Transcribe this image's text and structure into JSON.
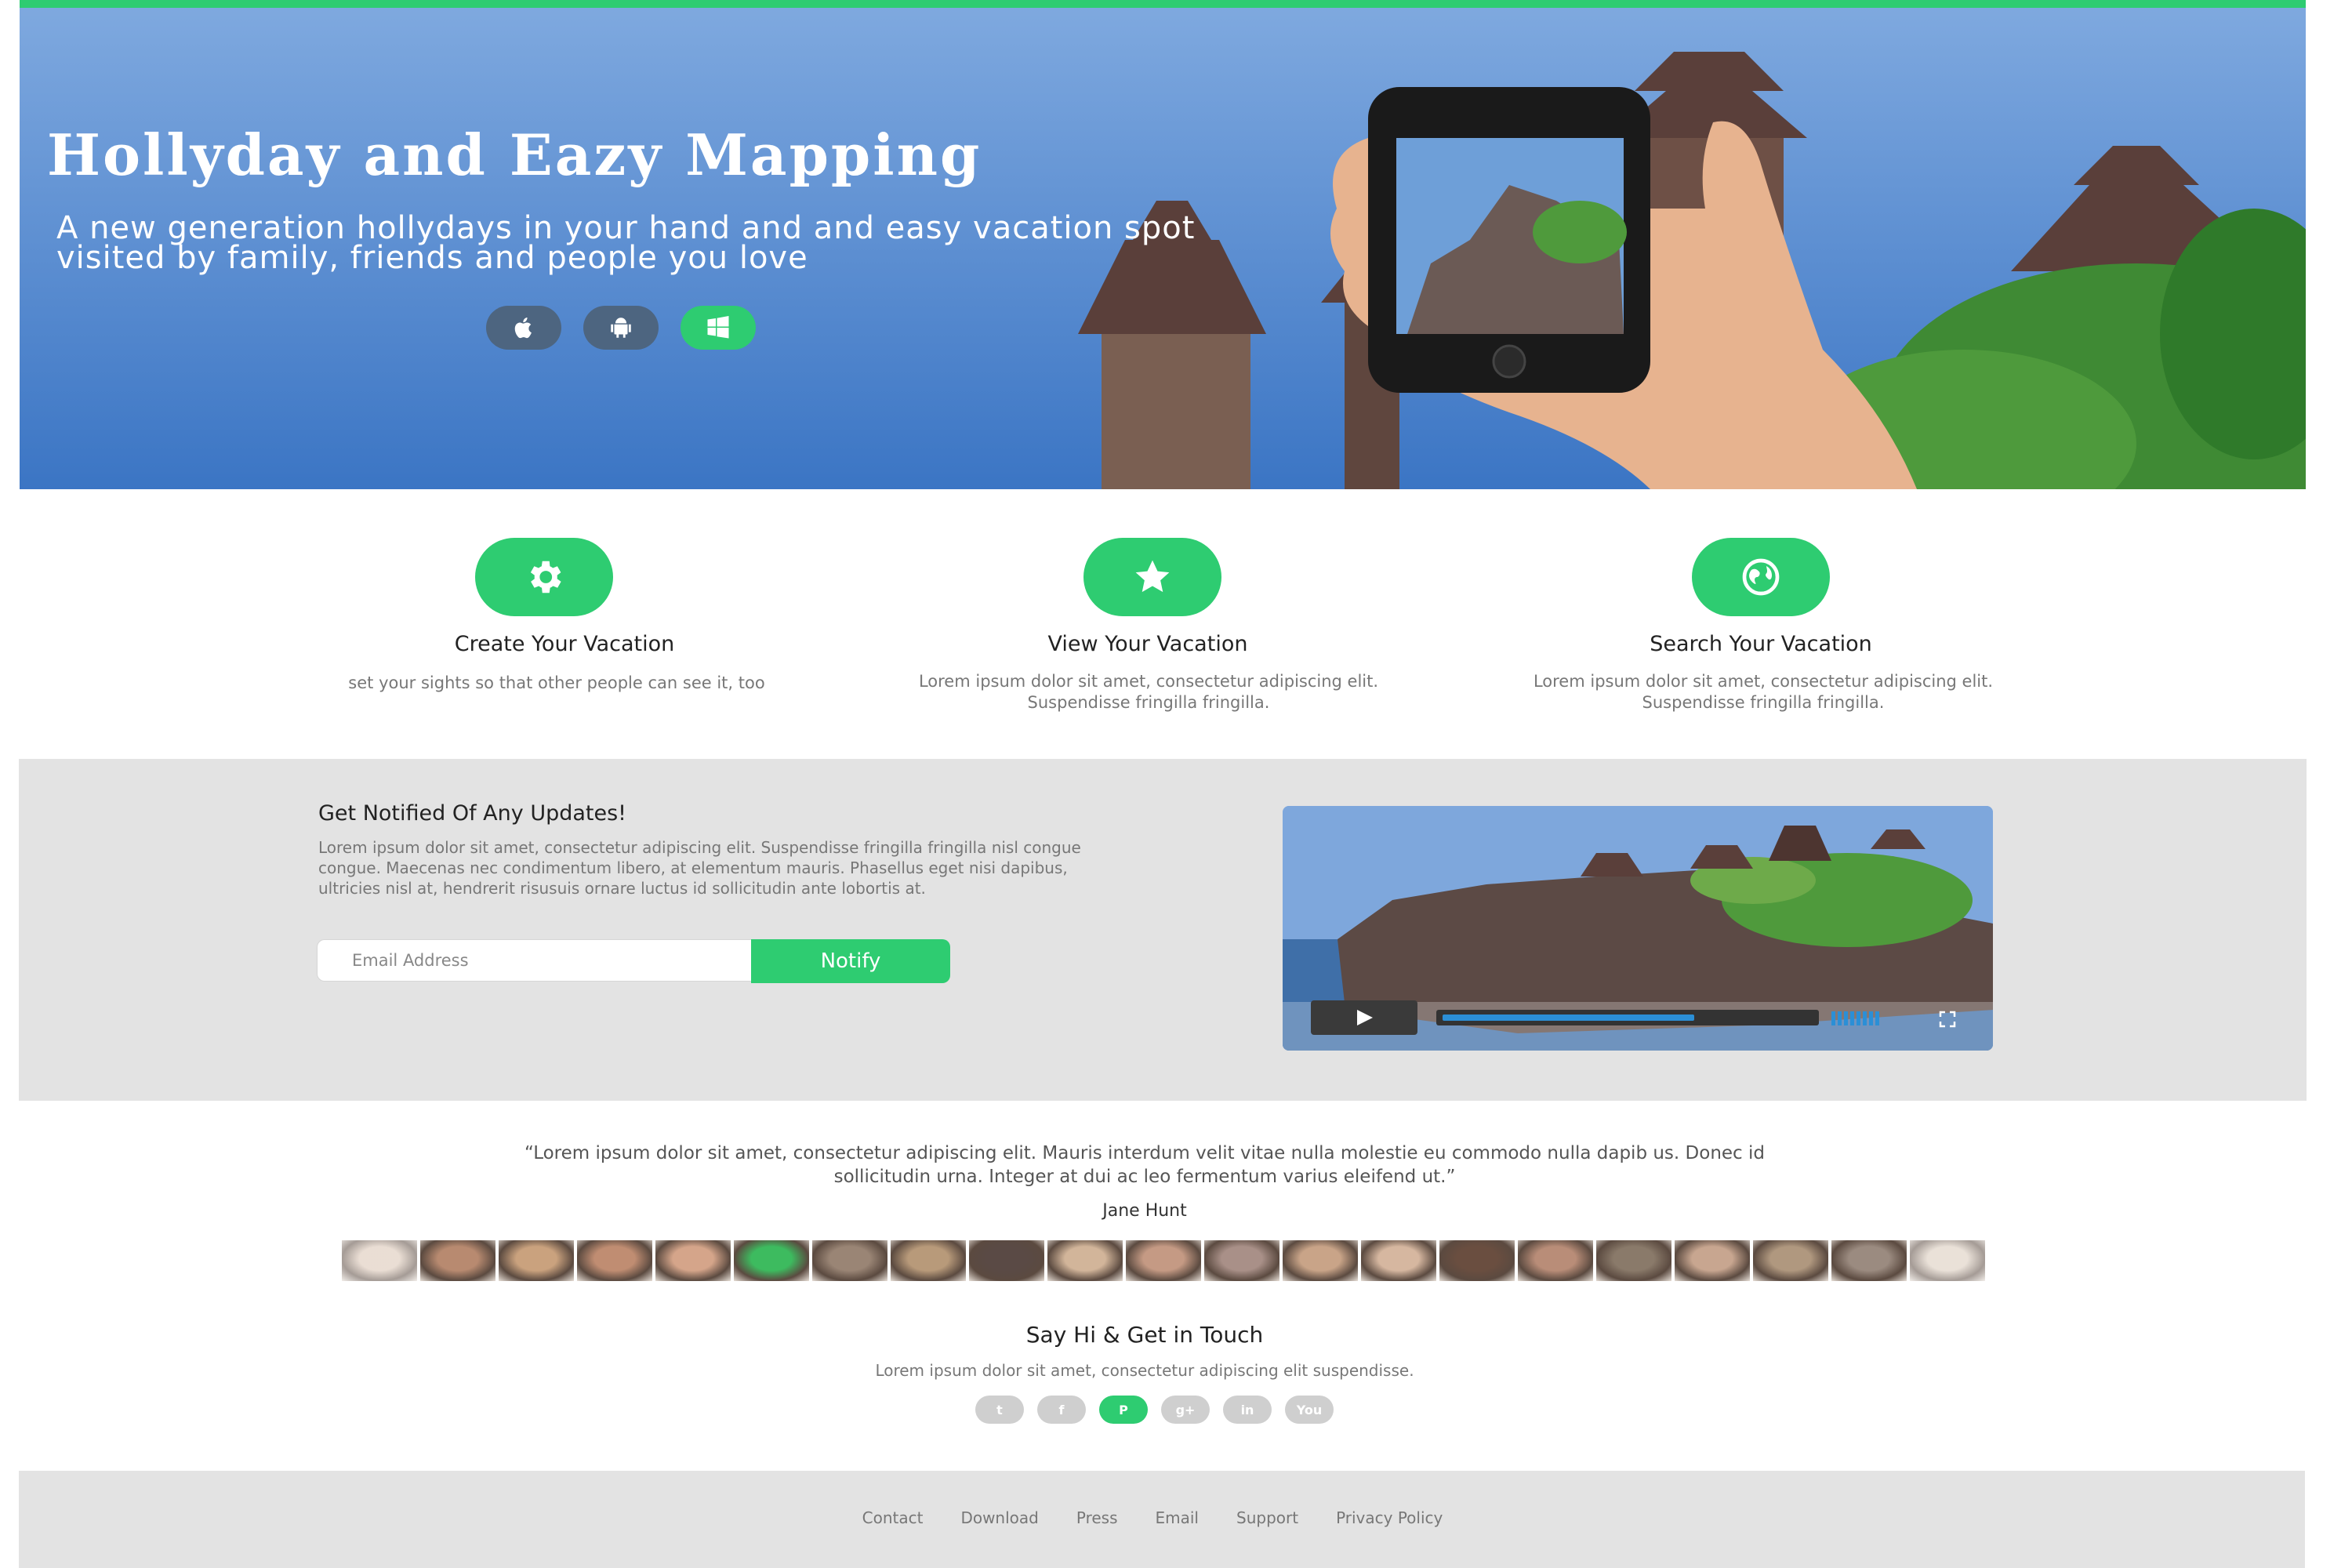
{
  "colors": {
    "accent": "#2ecc71",
    "dark_button": "#4d6580",
    "section_bg": "#e3e3e3"
  },
  "hero": {
    "title": "Hollyday and Eazy Mapping",
    "subtitle": "A new generation hollydays in your hand and and easy vacation spot visited by family, friends and people you love",
    "store_buttons": [
      {
        "icon": "apple-icon"
      },
      {
        "icon": "android-icon"
      },
      {
        "icon": "windows-icon"
      }
    ]
  },
  "features": [
    {
      "icon": "gear-icon",
      "title": "Create Your Vacation",
      "desc": "set your sights so that other people can see it, too"
    },
    {
      "icon": "star-icon",
      "title": "View Your Vacation",
      "desc": "Lorem ipsum dolor sit amet, consectetur adipiscing elit. Suspendisse fringilla fringilla."
    },
    {
      "icon": "globe-icon",
      "title": "Search Your Vacation",
      "desc": "Lorem ipsum dolor sit amet, consectetur adipiscing elit. Suspendisse fringilla fringilla."
    }
  ],
  "notify": {
    "title": "Get Notified Of Any Updates!",
    "desc": "Lorem ipsum dolor sit amet, consectetur adipiscing elit. Suspendisse fringilla fringilla nisl congue congue. Maecenas nec condimentum libero, at elementum mauris. Phasellus eget nisi dapibus, ultricies nisl at, hendrerit risusuis ornare luctus id sollicitudin ante lobortis at.",
    "email_placeholder": "Email Address",
    "button_label": "Notify"
  },
  "video": {
    "progress": 0.68
  },
  "testimonial": {
    "quote": "“Lorem ipsum dolor sit amet, consectetur adipiscing elit. Mauris interdum velit vitae nulla molestie eu commodo nulla dapib us. Donec id sollicitudin urna. Integer at dui ac leo fermentum varius eleifend ut.”",
    "author": "Jane Hunt",
    "avatars": [
      "#d8c2b0",
      "#b88a70",
      "#caa27e",
      "#c08d72",
      "#d5a58a",
      "#3dbb5f",
      "#9a8575",
      "#b89a7a",
      "#5a4a45",
      "#d2b59a",
      "#c59a84",
      "#a99088",
      "#c9a488",
      "#d6b7a0",
      "#6a4e40",
      "#b98d78",
      "#8a7a6a",
      "#c8a690",
      "#b0987f",
      "#9b8b80",
      "#d8c8b8"
    ]
  },
  "contact": {
    "title": "Say Hi & Get in Touch",
    "desc": "Lorem ipsum dolor sit amet, consectetur adipiscing elit suspendisse.",
    "social": [
      {
        "icon": "twitter-icon",
        "glyph": "t"
      },
      {
        "icon": "facebook-icon",
        "glyph": "f"
      },
      {
        "icon": "pinterest-icon",
        "glyph": "P"
      },
      {
        "icon": "googleplus-icon",
        "glyph": "g+"
      },
      {
        "icon": "linkedin-icon",
        "glyph": "in"
      },
      {
        "icon": "youtube-icon",
        "glyph": "You"
      }
    ]
  },
  "footer": {
    "links": [
      "Contact",
      "Download",
      "Press",
      "Email",
      "Support",
      "Privacy Policy"
    ]
  }
}
